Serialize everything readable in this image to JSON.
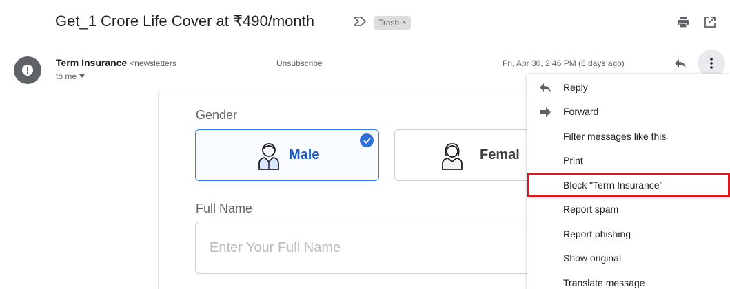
{
  "subject": {
    "title": "Get_1 Crore Life Cover at ₹490/month",
    "label": "Trash",
    "label_remove": "×"
  },
  "sender": {
    "name": "Term Insurance",
    "email_partial": "<newsletters",
    "to": "to me",
    "unsubscribe": "Unsubscribe",
    "date": "Fri, Apr 30, 2:46 PM (6 days ago)"
  },
  "form": {
    "gender_label": "Gender",
    "male": "Male",
    "female": "Femal",
    "fullname_label": "Full Name",
    "fullname_placeholder": "Enter Your Full Name"
  },
  "menu": {
    "items": [
      {
        "label": "Reply",
        "icon": "reply-icon"
      },
      {
        "label": "Forward",
        "icon": "forward-icon"
      },
      {
        "label": "Filter messages like this",
        "icon": ""
      },
      {
        "label": "Print",
        "icon": ""
      },
      {
        "label": "Block \"Term Insurance\"",
        "icon": "",
        "highlighted": true
      },
      {
        "label": "Report spam",
        "icon": ""
      },
      {
        "label": "Report phishing",
        "icon": ""
      },
      {
        "label": "Show original",
        "icon": ""
      },
      {
        "label": "Translate message",
        "icon": ""
      }
    ]
  },
  "colors": {
    "highlight_border": "#e3141c",
    "male_accent": "#2f80ed",
    "avatar_bg": "#5f6368"
  }
}
